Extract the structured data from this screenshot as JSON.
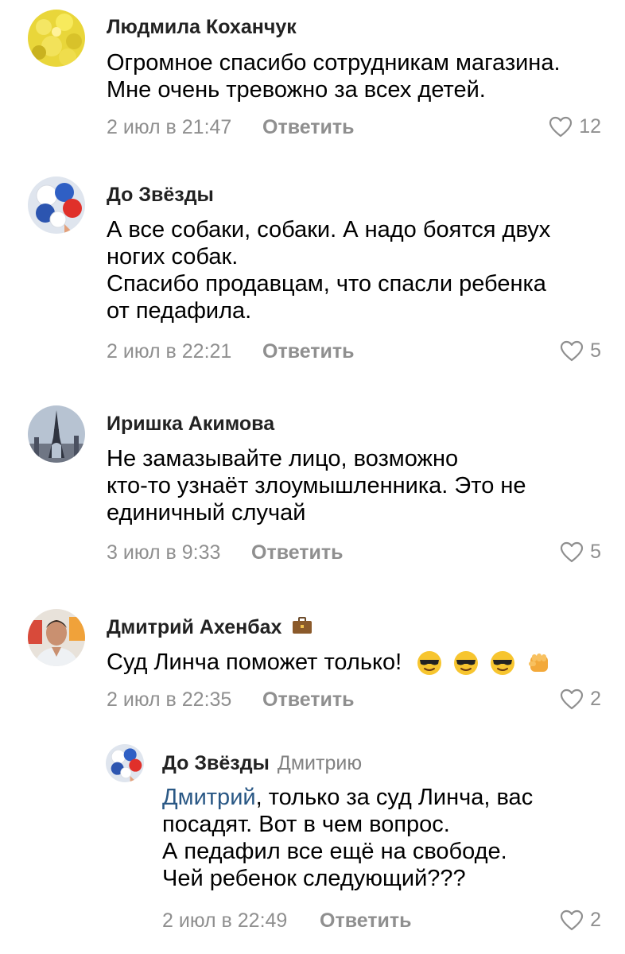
{
  "comments": [
    {
      "author": "Людмила Коханчук",
      "lines": [
        "Огромное спасибо сотрудникам магазина.",
        "Мне очень тревожно за всех детей."
      ],
      "date": "2 июл в 21:47",
      "reply_label": "Ответить",
      "likes": "12",
      "avatar": "yellow-flowers-avatar"
    },
    {
      "author": "До Звёзды",
      "lines": [
        "А все собаки, собаки. А надо боятся двух",
        "ногих собак.",
        "Спасибо продавцам, что спасли ребенка",
        "от педафила."
      ],
      "date": "2 июл в 22:21",
      "reply_label": "Ответить",
      "likes": "5",
      "avatar": "balloons-avatar"
    },
    {
      "author": "Иришка Акимова",
      "lines": [
        "Не замазывайте лицо, возможно",
        "кто-то узнаёт злоумышленника. Это не",
        "единичный случай"
      ],
      "date": "3 июл в 9:33",
      "reply_label": "Ответить",
      "likes": "5",
      "avatar": "eiffel-tower-avatar"
    },
    {
      "author": "Дмитрий Ахенбах",
      "author_icon": "briefcase-icon",
      "lines": [
        "Суд  Линча поможет только!"
      ],
      "emojis": [
        "sunglasses-emoji",
        "sunglasses-emoji",
        "sunglasses-emoji",
        "fist-emoji"
      ],
      "date": "2 июл в 22:35",
      "reply_label": "Ответить",
      "likes": "2",
      "avatar": "man-portrait-avatar"
    }
  ],
  "reply": {
    "author": "До Звёзды",
    "reply_to": "Дмитрию",
    "mention": "Дмитрий",
    "first_line_rest": ", только за суд Линча, вас",
    "lines": [
      "посадят. Вот в чем вопрос.",
      "А педафил все ещё на свободе.",
      "Чей ребенок следующий???"
    ],
    "date": "2 июл в 22:49",
    "reply_label": "Ответить",
    "likes": "2",
    "avatar": "balloons-avatar"
  },
  "colors": {
    "author": "#222222",
    "meta": "#8f8f8f",
    "mention": "#2a5885",
    "text": "#000000"
  }
}
